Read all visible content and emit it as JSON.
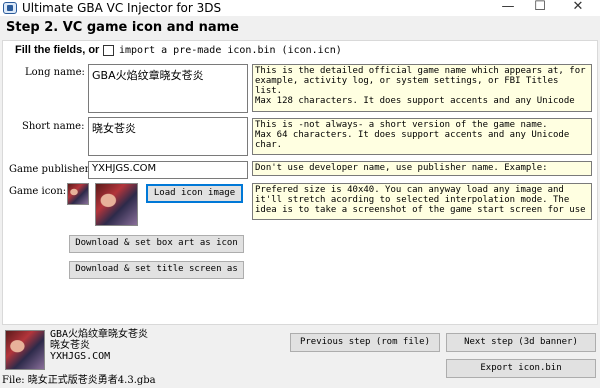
{
  "window": {
    "title": "Ultimate GBA VC Injector for 3DS",
    "controls": {
      "minimize": "—",
      "maximize": "☐",
      "close": "✕"
    }
  },
  "step_heading": "Step 2. VC game icon and name",
  "fill_fields": {
    "label": "Fill the fields, or",
    "import_checkbox_label": "import a pre-made icon.bin (icon.icn)",
    "import_checked": false
  },
  "long_name": {
    "label": "Long name:",
    "value": "GBA火焰纹章晓女苍炎",
    "hint": "This is the detailed official game name which appears at, for example, activity log, or system settings, or FBI Titles list.\nMax 128 characters. It does support accents and any Unicode"
  },
  "short_name": {
    "label": "Short name:",
    "value": "晓女苍炎",
    "hint": "This is -not always- a short version of the game name.\nMax 64 characters. It does support accents and any Unicode char."
  },
  "publisher": {
    "label": "Game publisher:",
    "value": "YXHJGS.COM",
    "hint": "Don't use developer name, use publisher name. Example:"
  },
  "game_icon": {
    "label": "Game icon:",
    "load_button": "Load icon image",
    "hint": "Prefered size is 40x40. You can anyway load any image and it'll stretch acording to selected interpolation mode. The idea is to take a screenshot of the game start screen for use"
  },
  "buttons": {
    "download_box_art": "Download & set box art as icon",
    "download_title_screen": "Download & set title screen as",
    "previous_step": "Previous step (rom file)",
    "next_step": "Next step (3d banner)",
    "export_icon": "Export icon.bin"
  },
  "preview": {
    "line1": "GBA火焰纹章晓女苍炎",
    "line2": "晓女苍炎",
    "line3": "YXHJGS.COM"
  },
  "status": {
    "file": "File: 晓女正式版苍炎勇者4.3.gba"
  }
}
